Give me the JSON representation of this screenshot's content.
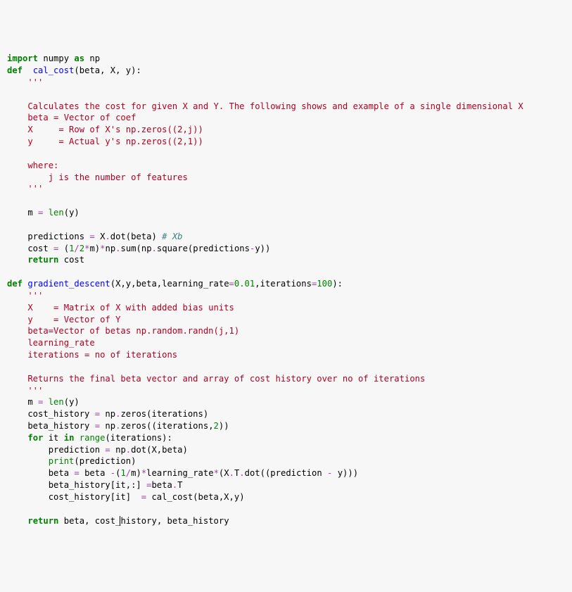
{
  "code": {
    "l01a": "import",
    "l01b": " numpy ",
    "l01c": "as",
    "l01d": " np",
    "l02a": "def",
    "l02b": "  ",
    "l02c": "cal_cost",
    "l02d": "(beta, X, y):",
    "l03": "    '''",
    "l05": "    Calculates the cost for given X and Y. The following shows and example of a single dimensional X",
    "l06": "    beta = Vector of coef",
    "l07": "    X     = Row of X's np.zeros((2,j))",
    "l08": "    y     = Actual y's np.zeros((2,1))",
    "l10": "    where:",
    "l11": "        j is the number of features",
    "l12": "    '''",
    "l14a": "    m ",
    "l14b": "=",
    "l14c": " ",
    "l14d": "len",
    "l14e": "(y)",
    "l16a": "    predictions ",
    "l16b": "=",
    "l16c": " X",
    "l16d": ".",
    "l16e": "dot(beta) ",
    "l16f": "# Xb",
    "l17a": "    cost ",
    "l17b": "=",
    "l17c": " (",
    "l17d": "1",
    "l17e": "/",
    "l17f": "2",
    "l17g": "*",
    "l17h": "m)",
    "l17i": "*",
    "l17j": "np",
    "l17k": ".",
    "l17l": "sum(np",
    "l17m": ".",
    "l17n": "square(predictions",
    "l17o": "-",
    "l17p": "y))",
    "l18a": "    ",
    "l18b": "return",
    "l18c": " cost",
    "l20a": "def",
    "l20b": " ",
    "l20c": "gradient_descent",
    "l20d": "(X,y,beta,learning_rate",
    "l20e": "=",
    "l20f": "0.01",
    "l20g": ",iterations",
    "l20h": "=",
    "l20i": "100",
    "l20j": "):",
    "l21": "    '''",
    "l22": "    X    = Matrix of X with added bias units",
    "l23": "    y    = Vector of Y",
    "l24": "    beta=Vector of betas np.random.randn(j,1)",
    "l25": "    learning_rate ",
    "l26": "    iterations = no of iterations",
    "l28": "    Returns the final beta vector and array of cost history over no of iterations",
    "l29": "    '''",
    "l30a": "    m ",
    "l30b": "=",
    "l30c": " ",
    "l30d": "len",
    "l30e": "(y)",
    "l31a": "    cost_history ",
    "l31b": "=",
    "l31c": " np",
    "l31d": ".",
    "l31e": "zeros(iterations)",
    "l32a": "    beta_history ",
    "l32b": "=",
    "l32c": " np",
    "l32d": ".",
    "l32e": "zeros((iterations,",
    "l32f": "2",
    "l32g": "))",
    "l33a": "    ",
    "l33b": "for",
    "l33c": " it ",
    "l33d": "in",
    "l33e": " ",
    "l33f": "range",
    "l33g": "(iterations):",
    "l34a": "        prediction ",
    "l34b": "=",
    "l34c": " np",
    "l34d": ".",
    "l34e": "dot(X,beta)",
    "l35a": "        ",
    "l35b": "print",
    "l35c": "(prediction)",
    "l36a": "        beta ",
    "l36b": "=",
    "l36c": " beta ",
    "l36d": "-",
    "l36e": "(",
    "l36f": "1",
    "l36g": "/",
    "l36h": "m)",
    "l36i": "*",
    "l36j": "learning_rate",
    "l36k": "*",
    "l36l": "(X",
    "l36m": ".",
    "l36n": "T",
    "l36o": ".",
    "l36p": "dot((prediction ",
    "l36q": "-",
    "l36r": " y)))",
    "l37a": "        beta_history[it,:] ",
    "l37b": "=",
    "l37c": "beta",
    "l37d": ".",
    "l37e": "T",
    "l38a": "        cost_history[it]  ",
    "l38b": "=",
    "l38c": " cal_cost(beta,X,y)",
    "l40a": "    ",
    "l40b": "return",
    "l40c": " beta, cost_",
    "l40d": "history, beta_history"
  }
}
